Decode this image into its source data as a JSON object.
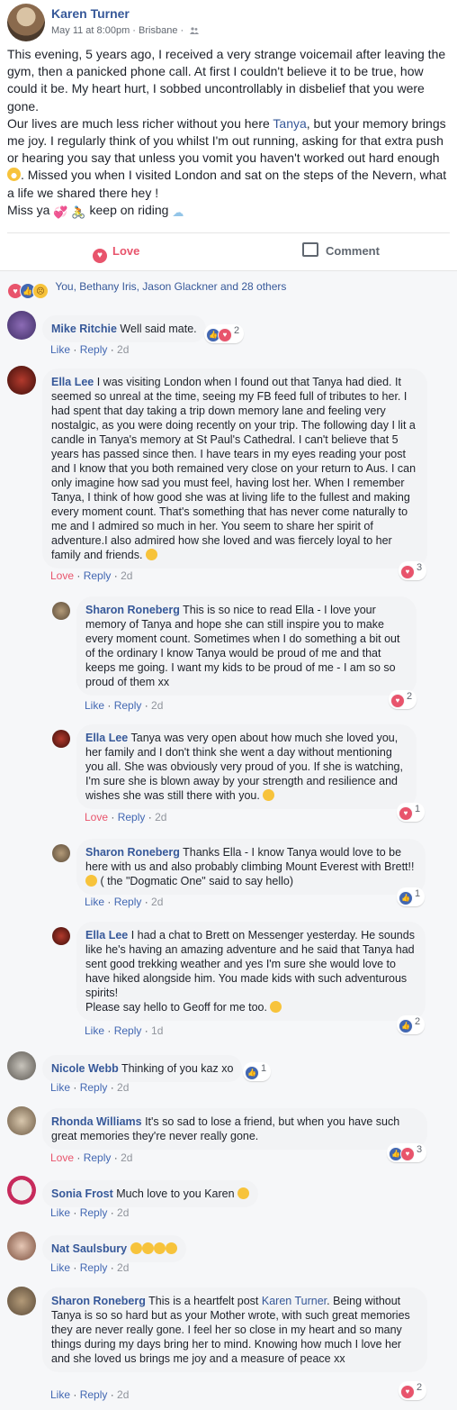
{
  "post": {
    "author": "Karen Turner",
    "date": "May 11 at 8:00pm",
    "location": "Brisbane",
    "paragraph1": "This evening, 5 years ago, I received a very strange voicemail after leaving the gym, then a panicked phone call. At first I couldn't believe it to be true, how could it be. My heart hurt, I sobbed uncontrollably in disbelief that you were gone.",
    "p2_a": "Our lives are much less richer without you here ",
    "p2_tag": "Tanya",
    "p2_b": ", but your memory brings me joy. I regularly think of you whilst I'm out running, asking for that extra push or hearing you say that unless you vomit you haven't worked out hard enough ",
    "p2_c": ". Missed you when I visited London and sat on the steps of the Nevern, what a life we shared there hey !",
    "p3_a": "Miss ya ",
    "p3_b": " keep on riding ",
    "love_label": "Love",
    "comment_label": "Comment"
  },
  "reactions_summary": "You, Bethany Iris, Jason Glackner and 28 others",
  "comments": [
    {
      "name": "Mike Ritchie",
      "text": "Well said mate.",
      "actions": [
        "Like",
        "Reply",
        "2d"
      ],
      "count": "2",
      "reactions": [
        "like",
        "love"
      ]
    },
    {
      "name": "Ella Lee",
      "text": "I was visiting London when I found out that Tanya had died. It seemed so unreal at the time, seeing my FB feed full of tributes to her. I had spent that day taking a trip down memory lane and feeling very nostalgic, as you were doing recently on your trip. The following day I lit a candle in Tanya's memory at St Paul's Cathedral. I can't believe that 5 years has passed since then. I have tears in my eyes reading your post and I know that you both remained very close on your return to Aus. I can only imagine how sad you must feel, having lost her. When I remember Tanya, I think of how good she was at living life to the fullest and making every moment count. That's something that has never come naturally to me and I admired so much in her. You seem to share her spirit of adventure.I also admired how she loved and was fiercely loyal to her family and friends.",
      "actions": [
        "Love",
        "Reply",
        "2d"
      ],
      "count": "3",
      "reactions": [
        "love"
      ]
    },
    {
      "name": "Sharon Roneberg",
      "text": "This is so nice to read Ella - I love your memory of Tanya and hope she can still inspire you to make every moment count. Sometimes when I do something a bit out of the ordinary I know Tanya would be proud of me and that keeps me going. I want my kids to be proud of me - I am so so proud of them xx",
      "actions": [
        "Like",
        "Reply",
        "2d"
      ],
      "count": "2",
      "reactions": [
        "love"
      ]
    },
    {
      "name": "Ella Lee",
      "text": "Tanya was very open about how much she loved you, her family and I don't think she went a day without mentioning you all. She was obviously very proud of you. If she is watching, I'm sure she is blown away by your strength and resilience and wishes she was still there with you.",
      "actions": [
        "Love",
        "Reply",
        "2d"
      ],
      "count": "1",
      "reactions": [
        "love"
      ]
    },
    {
      "name": "Sharon Roneberg",
      "text": "Thanks Ella - I know Tanya would love to be here with us and also probably climbing Mount Everest with Brett!!",
      "text2": " ( the \"Dogmatic One\" said to say hello)",
      "actions": [
        "Like",
        "Reply",
        "2d"
      ],
      "count": "1",
      "reactions": [
        "like"
      ]
    },
    {
      "name": "Ella Lee",
      "text": "I had a chat to Brett on Messenger yesterday. He sounds like he's having an amazing adventure and he said that Tanya had sent good trekking weather and yes I'm sure she would love to have hiked alongside him. You made kids with such adventurous spirits!",
      "text2": "Please say hello to Geoff for me too.",
      "actions": [
        "Like",
        "Reply",
        "1d"
      ],
      "count": "2",
      "reactions": [
        "like"
      ]
    },
    {
      "name": "Nicole Webb",
      "text": "Thinking of you kaz xo",
      "actions": [
        "Like",
        "Reply",
        "2d"
      ],
      "count": "1",
      "reactions": [
        "like"
      ]
    },
    {
      "name": "Rhonda Williams",
      "text": "It's so sad to lose a friend, but when you have such great memories they're never really gone.",
      "actions": [
        "Love",
        "Reply",
        "2d"
      ],
      "count": "3",
      "reactions": [
        "like",
        "love"
      ]
    },
    {
      "name": "Sonia Frost",
      "text": "Much love to you Karen",
      "actions": [
        "Like",
        "Reply",
        "2d"
      ]
    },
    {
      "name": "Nat Saulsbury",
      "text": "",
      "actions": [
        "Like",
        "Reply",
        "2d"
      ]
    },
    {
      "name": "Sharon Roneberg",
      "text": "This is a heartfelt post ",
      "tag": "Karen Turner",
      "text2": ". Being without Tanya is so so hard but as your Mother wrote, with such great memories they are never really gone. I feel her so close in my heart and so many things during my days bring her to mind. Knowing how much I love her and she loved us brings me joy and a measure of peace xx",
      "actions": [
        "Like",
        "Reply",
        "2d"
      ],
      "count": "2",
      "reactions": [
        "love"
      ]
    }
  ],
  "colors": {
    "link": "#365899",
    "love": "#e8546c",
    "like": "#4267b2",
    "text": "#1d2129",
    "muted": "#90949c",
    "bubble": "#f2f3f5"
  }
}
